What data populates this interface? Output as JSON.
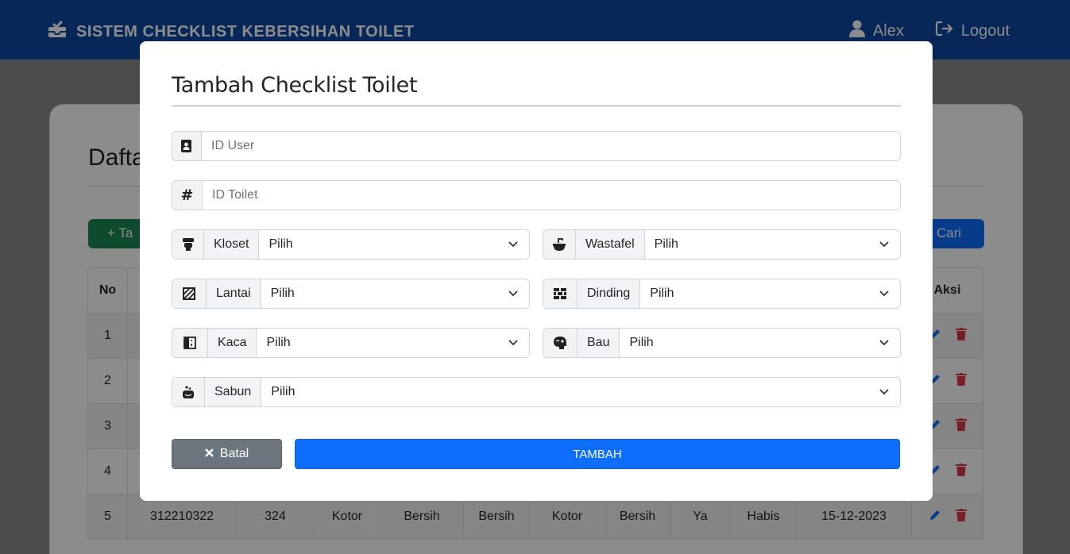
{
  "navbar": {
    "brand": "SISTEM CHECKLIST KEBERSIHAN TOILET",
    "user": "Alex",
    "logout": "Logout"
  },
  "page": {
    "title": "Daftar Checklist",
    "add_button": "+ Ta",
    "search_button": "Cari",
    "table": {
      "headers": [
        "No",
        "",
        "",
        "",
        "",
        "",
        "",
        "",
        "",
        "",
        "",
        "Aksi"
      ],
      "rows": [
        [
          "1",
          "",
          "",
          "",
          "",
          "",
          "",
          "",
          "",
          "",
          ""
        ],
        [
          "2",
          "",
          "",
          "",
          "",
          "",
          "",
          "",
          "",
          "",
          ""
        ],
        [
          "3",
          "",
          "",
          "",
          "",
          "",
          "",
          "",
          "",
          "",
          ""
        ],
        [
          "4",
          "",
          "",
          "",
          "",
          "",
          "",
          "",
          "",
          "",
          ""
        ],
        [
          "5",
          "312210322",
          "324",
          "Kotor",
          "Bersih",
          "Bersih",
          "Kotor",
          "Bersih",
          "Ya",
          "Habis",
          "15-12-2023"
        ]
      ]
    }
  },
  "modal": {
    "title": "Tambah Checklist Toilet",
    "id_user_placeholder": "ID User",
    "id_toilet_placeholder": "ID Toilet",
    "fields": {
      "kloset": {
        "label": "Kloset",
        "value": "Pilih",
        "icon": "toilet-icon"
      },
      "wastafel": {
        "label": "Wastafel",
        "value": "Pilih",
        "icon": "sink-icon"
      },
      "lantai": {
        "label": "Lantai",
        "value": "Pilih",
        "icon": "floor-icon"
      },
      "dinding": {
        "label": "Dinding",
        "value": "Pilih",
        "icon": "wall-icon"
      },
      "kaca": {
        "label": "Kaca",
        "value": "Pilih",
        "icon": "mirror-icon"
      },
      "bau": {
        "label": "Bau",
        "value": "Pilih",
        "icon": "smell-icon"
      },
      "sabun": {
        "label": "Sabun",
        "value": "Pilih",
        "icon": "soap-icon"
      }
    },
    "cancel_label": "Batal",
    "submit_label": "TAMBAH"
  },
  "colors": {
    "navbar": "#0d47a1",
    "primary": "#0d6efd",
    "secondary": "#6c757d",
    "success": "#198754",
    "danger": "#dc3545"
  }
}
